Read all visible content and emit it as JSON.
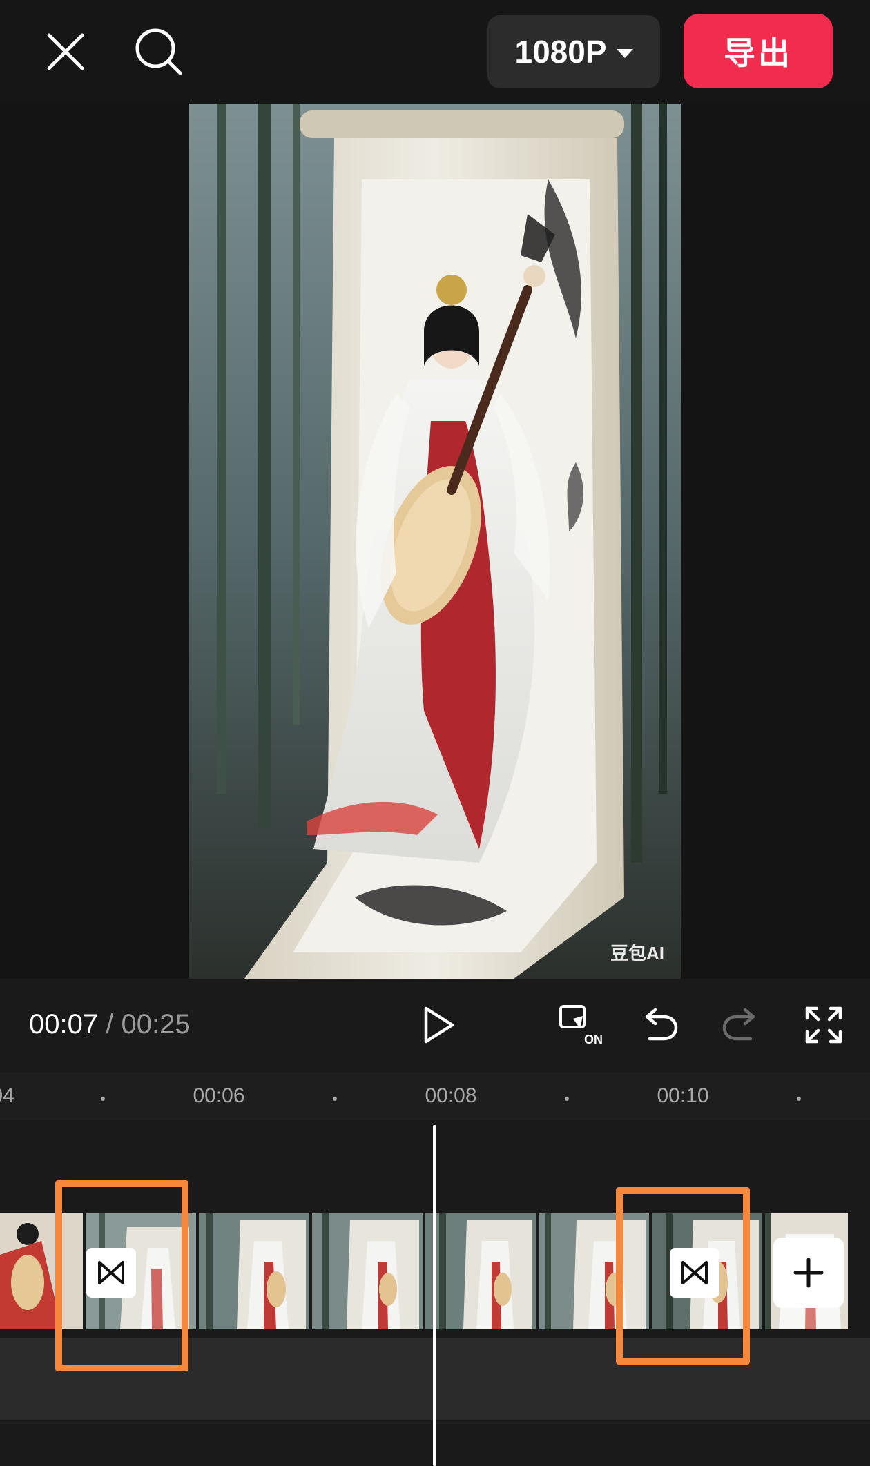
{
  "topbar": {
    "close_icon": "close-icon",
    "search_icon": "search-icon",
    "resolution": "1080P",
    "export_label": "导出"
  },
  "preview": {
    "watermark": "豆包AI"
  },
  "controls": {
    "current_time": "00:07",
    "separator": "/",
    "total_time": "00:25",
    "icons": [
      "play-icon",
      "keyframe-on-icon",
      "undo-icon",
      "redo-icon",
      "fullscreen-icon"
    ],
    "keyframe_badge": "ON"
  },
  "ruler": {
    "labels": [
      "04",
      "00:06",
      "00:08",
      "00:10"
    ]
  },
  "colors": {
    "accent": "#f22c4f",
    "highlight": "#f7873a",
    "background": "#1a1a1a"
  }
}
